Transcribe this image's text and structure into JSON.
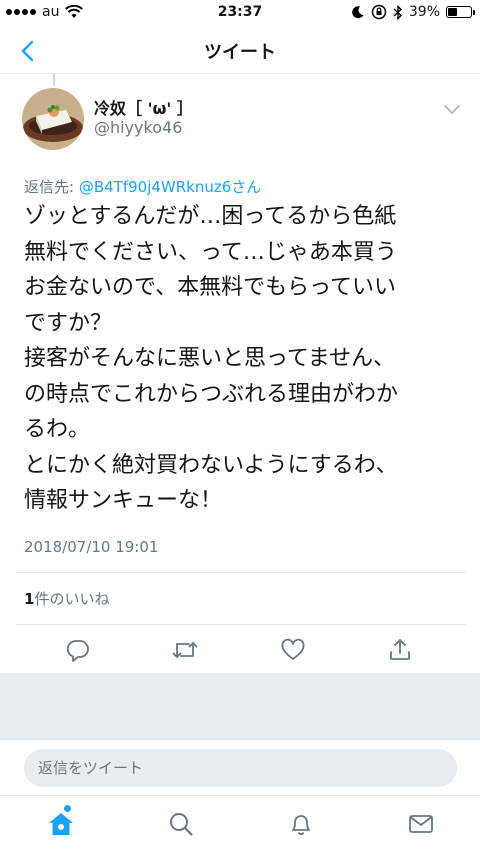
{
  "status_bar": {
    "carrier": "au",
    "time": "23:37",
    "battery_percent": "39%",
    "battery_level": 0.39
  },
  "nav": {
    "title": "ツイート"
  },
  "tweet": {
    "display_name": "冷奴［ 'ω' ］",
    "handle": "@hiyyko46",
    "reply_prefix": "返信先: ",
    "reply_to": "@B4Tf90j4WRknuz6さん",
    "text_lines": [
      "ゾッとするんだが…困ってるから色紙",
      "無料でください、って…じゃあ本買う",
      "お金ないので、本無料でもらっていい",
      "ですか？",
      "接客がそんなに悪いと思ってません、",
      "の時点でこれからつぶれる理由がわか",
      "るわ。",
      "とにかく絶対買わないようにするわ、",
      "情報サンキューな！"
    ],
    "timestamp": "2018/07/10 19:01",
    "like_count": "1",
    "like_label": "件のいいね"
  },
  "reply_bar": {
    "placeholder": "返信をツイート"
  },
  "colors": {
    "accent": "#1da1f2",
    "secondary_text": "#657786",
    "divider": "#e1e8ed",
    "background_gray": "#e6ecf0"
  }
}
